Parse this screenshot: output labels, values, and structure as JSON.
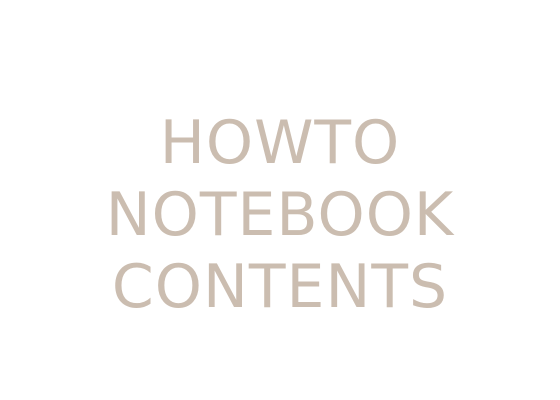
{
  "title": {
    "lines": [
      "HOWTO",
      "NOTEBOOK",
      "CONTENTS"
    ]
  },
  "colors": {
    "background": "#ffffff",
    "title_text": "#cbbdb0"
  }
}
